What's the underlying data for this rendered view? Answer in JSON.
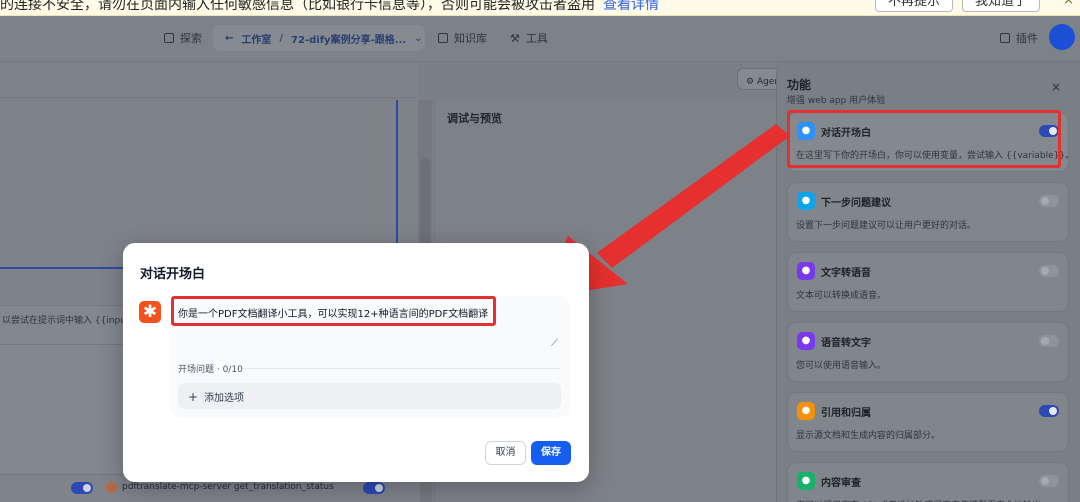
{
  "banner": {
    "text": "的连接不安全，请勿在页面内输入任何敏感信息（比如银行卡信息等），否则可能会被攻击者盗用",
    "link": "查看详情",
    "dismiss_label": "不再提示",
    "ack_label": "我知道了",
    "close": "×"
  },
  "topnav": {
    "explore": "探索",
    "studio": "工作室",
    "app_name": "72-dify案例分享-跟格...",
    "knowledge": "知识库",
    "tools": "工具",
    "plugins": "插件"
  },
  "editor": {
    "input_hint": "以尝试在提示词中输入 {{input}}",
    "tool_name": "pdftranslate-mcp-server  get_translation_status",
    "agent_label": "Agent 设置"
  },
  "preview": {
    "title": "调试与预览"
  },
  "features": {
    "title": "功能",
    "subtitle": "增强 web app 用户体验",
    "close": "×",
    "items": [
      {
        "name": "对话开场白",
        "desc": "在这里写下你的开场白，你可以使用变量，尝试输入 {{variable}}。",
        "enabled": true,
        "icon": "chat-bubble-icon",
        "color": "#2e90fa"
      },
      {
        "name": "下一步问题建议",
        "desc": "设置下一步问题建议可以让用户更好的对话。",
        "enabled": false,
        "icon": "message-icon",
        "color": "#0ba5ec"
      },
      {
        "name": "文字转语音",
        "desc": "文本可以转换成语音。",
        "enabled": false,
        "icon": "text-to-speech-icon",
        "color": "#7839ee"
      },
      {
        "name": "语音转文字",
        "desc": "您可以使用语音输入。",
        "enabled": false,
        "icon": "microphone-icon",
        "color": "#7839ee"
      },
      {
        "name": "引用和归属",
        "desc": "显示源文档和生成内容的归属部分。",
        "enabled": true,
        "icon": "citation-icon",
        "color": "#f79009"
      },
      {
        "name": "内容审查",
        "desc": "您可以调用审查 API 或者维护敏感词库来使模型更安全地输出。",
        "enabled": false,
        "icon": "shield-icon",
        "color": "#17b26a"
      }
    ]
  },
  "modal": {
    "title": "对话开场白",
    "badge": "✱",
    "opener_value": "你是一个PDF文档翻译小工具，可以实现12+种语言间的PDF文档翻译",
    "questions_label": "开场问题 · 0/10",
    "add_option": "添加选项",
    "cancel": "取消",
    "save": "保存"
  },
  "colors": {
    "primary": "#155eef",
    "highlight": "#e5302f",
    "badge": "#f4511e"
  }
}
